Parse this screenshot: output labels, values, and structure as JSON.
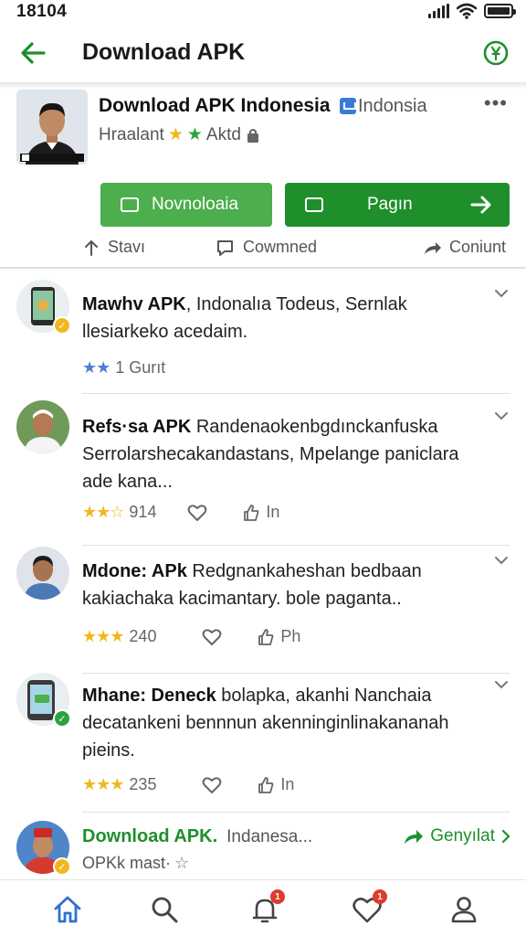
{
  "status_bar": {
    "time": "18104"
  },
  "app_bar": {
    "title": "Download APK"
  },
  "hero": {
    "title": "Download APK Indonesia",
    "region": "Indonsia",
    "more": "•••",
    "subtitle_left": "Hraalant",
    "subtitle_right": "Aktd",
    "rating_stars": 2,
    "primary_button_label": "Novnoloaia",
    "secondary_button_label": "Pagın",
    "actions": [
      {
        "label": "Stavı",
        "icon": "share-up-icon"
      },
      {
        "label": "Cowmned",
        "icon": "comment-icon"
      },
      {
        "label": "Coniunt",
        "icon": "forward-icon"
      }
    ]
  },
  "posts": [
    {
      "title": "Mawhv APK",
      "text": ", Indonalıa Todeus, Sernlak llesiarkeko acedaim.",
      "stars": "★★",
      "stars_color": "#4f7fd6",
      "rating_label": "1 Gurıt",
      "like_icon": "",
      "count": "",
      "share_label": "",
      "badge_color": "#f2b71e"
    },
    {
      "title": "Refs·sa APK",
      "text": " Randenaokenbgdınckanfuska Serrolarshecakandastans, Mpelange paniclara ade kana...",
      "stars": "★★☆",
      "stars_color": "#f2b71e",
      "count": "914",
      "share_label": "In",
      "badge_color": ""
    },
    {
      "title": "Mdone: APk",
      "text": " Redgnankaheshan bedbaan kakiachaka kacimantary. bole paganta..",
      "stars": "★★★",
      "stars_color": "#f2b71e",
      "count": "240",
      "share_label": "Ph",
      "badge_color": ""
    },
    {
      "title": "Mhane: Deneck",
      "text": " bolapka, akanhi Nanchaia decatankeni bennnun akenninginlinakananah pieins.",
      "stars": "★★★",
      "stars_color": "#f2b71e",
      "count": "235",
      "share_label": "In",
      "badge_color": "#2aa33a"
    }
  ],
  "last_post": {
    "title": "Download APK.",
    "region": "Indanesa...",
    "subtitle": "OPKk mast·",
    "action_label": "Genyılat",
    "badge_color": "#f2b71e"
  },
  "bottom_nav": {
    "items": [
      {
        "name": "home",
        "badge": ""
      },
      {
        "name": "search",
        "badge": ""
      },
      {
        "name": "notifications",
        "badge": "1"
      },
      {
        "name": "favorites",
        "badge": "1"
      },
      {
        "name": "profile",
        "badge": ""
      }
    ]
  },
  "colors": {
    "accent_green": "#1e8f2a",
    "light_green": "#4cae4c",
    "nav_blue": "#2f6fd0",
    "star_yellow": "#f2b71e"
  }
}
